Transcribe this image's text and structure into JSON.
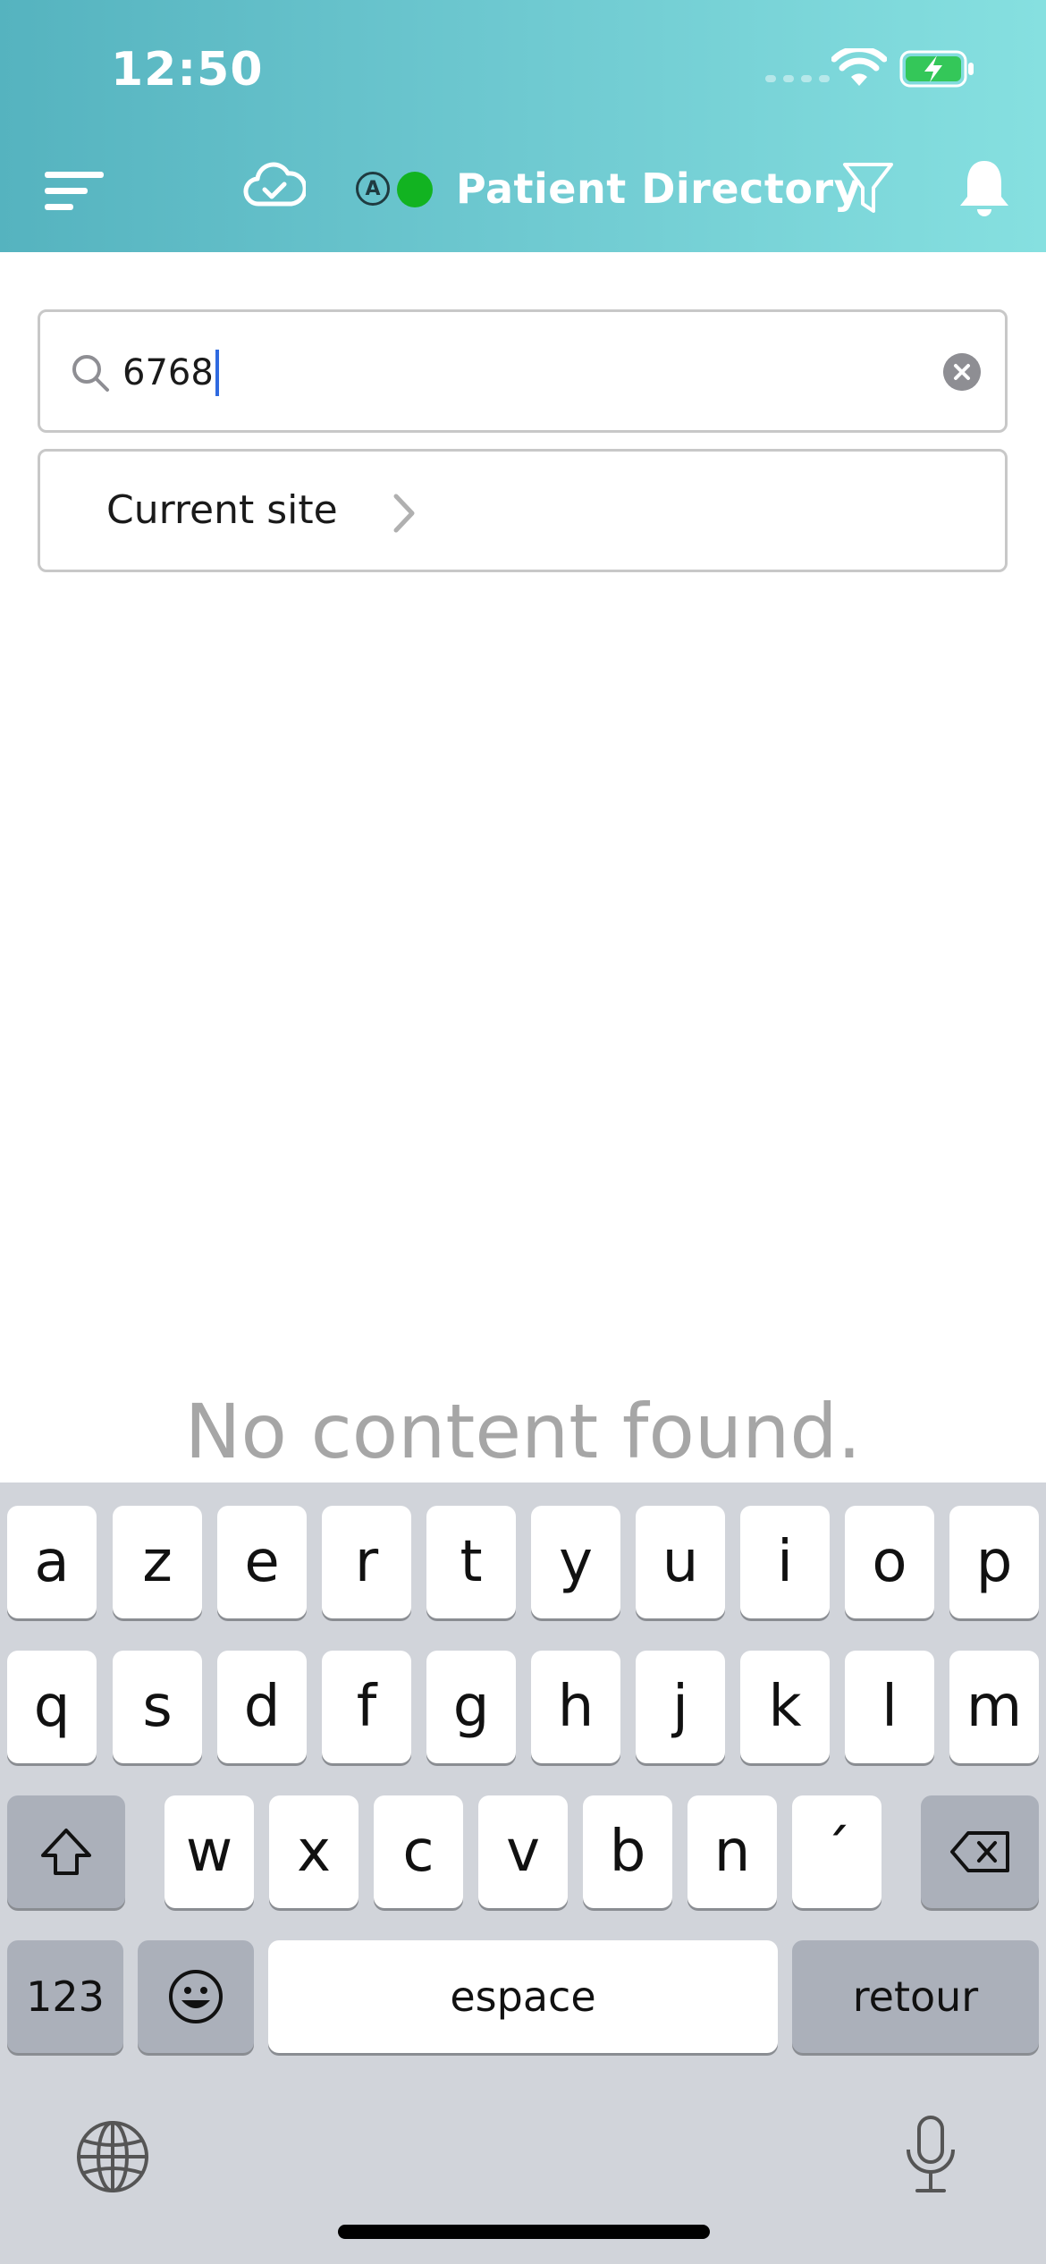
{
  "status_bar": {
    "time": "12:50"
  },
  "header": {
    "title": "Patient Directory",
    "mode_badge": "A",
    "online_color": "#12b321",
    "icons": [
      "menu-icon",
      "cloud-check-icon",
      "filter-icon",
      "bell-icon"
    ]
  },
  "search": {
    "value": "6768"
  },
  "site_selector": {
    "label": "Current site"
  },
  "empty_state": {
    "message": "No content found."
  },
  "keyboard": {
    "row1": [
      "a",
      "z",
      "e",
      "r",
      "t",
      "y",
      "u",
      "i",
      "o",
      "p"
    ],
    "row2": [
      "q",
      "s",
      "d",
      "f",
      "g",
      "h",
      "j",
      "k",
      "l",
      "m"
    ],
    "row3": [
      "w",
      "x",
      "c",
      "v",
      "b",
      "n",
      "´"
    ],
    "numbers_label": "123",
    "space_label": "espace",
    "return_label": "retour"
  },
  "colors": {
    "header_start": "#55b3bf",
    "header_end": "#86e0e0",
    "caret": "#2f6ae0"
  }
}
